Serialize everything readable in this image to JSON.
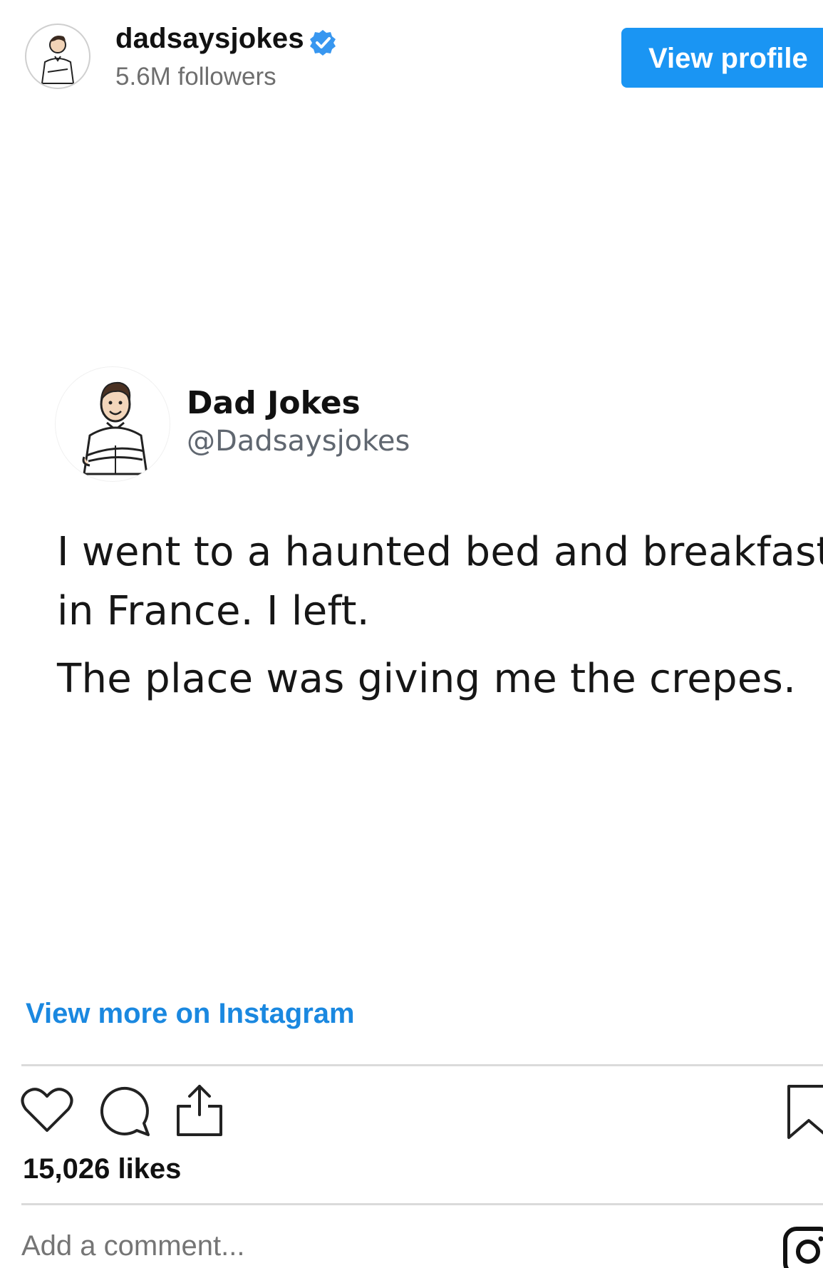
{
  "header": {
    "username": "dadsaysjokes",
    "followers": "5.6M followers",
    "view_profile_label": "View profile"
  },
  "tweet": {
    "display_name": "Dad Jokes",
    "handle": "@Dadsaysjokes",
    "lines": [
      "I went to a haunted bed and breakfast",
      "in France. I left.",
      "The place was giving me the crepes."
    ]
  },
  "links": {
    "view_more": "View more on Instagram"
  },
  "actions": {
    "likes": "15,026 likes",
    "icons": [
      "heart-icon",
      "comment-icon",
      "share-icon",
      "bookmark-icon"
    ]
  },
  "comment": {
    "placeholder": "Add a comment..."
  },
  "colors": {
    "accent": "#1a95f3",
    "link": "#1a88e0",
    "verified": "#3897f0"
  }
}
